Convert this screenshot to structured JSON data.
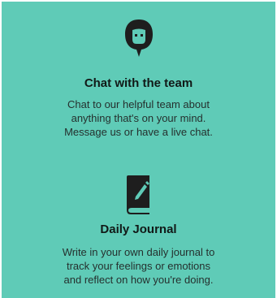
{
  "theme": {
    "panel_color": "#5fcbb7",
    "icon_color": "#1e1e1e"
  },
  "features": [
    {
      "icon": "chat-bubble-face-icon",
      "title": "Chat with the team",
      "description_lines": [
        "Chat to our helpful team about",
        "anything that's on your mind.",
        "Message us or have a live chat."
      ]
    },
    {
      "icon": "journal-pen-icon",
      "title": "Daily Journal",
      "description_lines": [
        "Write in your own daily journal to",
        "track your feelings or emotions",
        "and reflect on how you're doing."
      ]
    }
  ]
}
